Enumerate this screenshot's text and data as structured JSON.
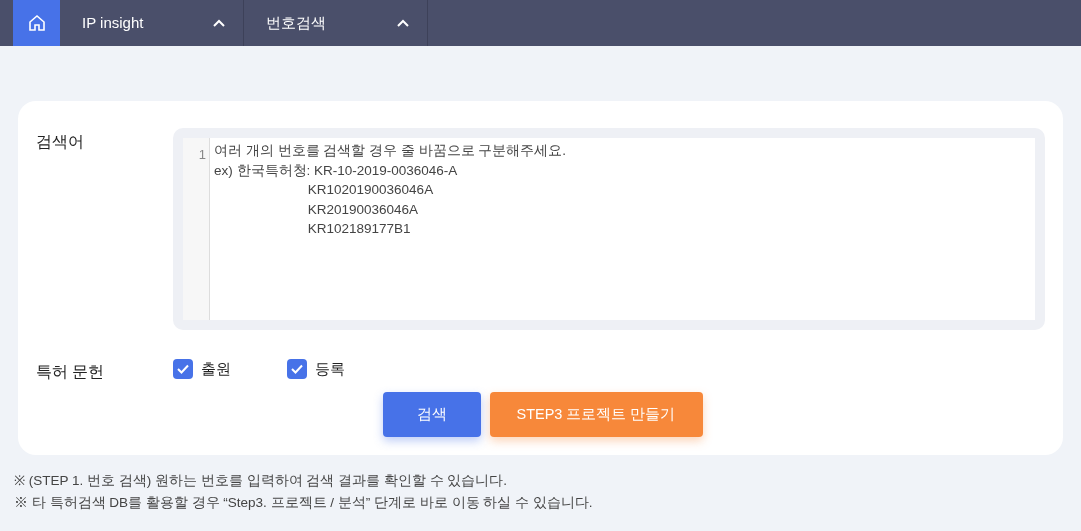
{
  "nav": {
    "home": {
      "selected": true
    },
    "items": [
      {
        "label": "IP insight",
        "expanded": true
      },
      {
        "label": "번호검색",
        "expanded": true
      }
    ]
  },
  "form": {
    "query_label": "검색어",
    "line_number": "1",
    "placeholder": "여러 개의 번호를 검색할 경우 줄 바꿈으로 구분해주세요.\nex) 한국특허청: KR-10-2019-0036046-A\n                         KR1020190036046A\n                         KR20190036046A\n                         KR102189177B1",
    "doc_label": "특허 문헌",
    "doc_types": [
      {
        "label": "출원",
        "checked": true
      },
      {
        "label": "등록",
        "checked": true
      }
    ],
    "buttons": [
      {
        "label": "검색",
        "kind": "primary"
      },
      {
        "label": "STEP3 프로젝트 만들기",
        "kind": "secondary"
      }
    ]
  },
  "notes": [
    "※ (STEP 1. 번호 검색) 원하는 번호를 입력하여 검색 결과를 확인할 수 있습니다.",
    "※ 타 특허검색 DB를 활용할 경우 “Step3. 프로젝트 / 분석” 단계로 바로 이동 하실 수 있습니다."
  ]
}
